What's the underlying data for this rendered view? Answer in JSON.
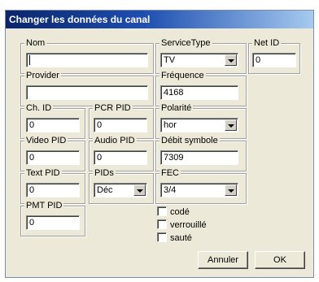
{
  "window": {
    "title": "Changer les données du canal"
  },
  "fields": {
    "nom": {
      "label": "Nom",
      "value": ""
    },
    "service_type": {
      "label": "ServiceType",
      "value": "TV"
    },
    "net_id": {
      "label": "Net ID",
      "value": "0"
    },
    "provider": {
      "label": "Provider",
      "value": ""
    },
    "frequence": {
      "label": "Fréquence",
      "value": "4168"
    },
    "ch_id": {
      "label": "Ch. ID",
      "value": "0"
    },
    "pcr_pid": {
      "label": "PCR PID",
      "value": "0"
    },
    "polarite": {
      "label": "Polarité",
      "value": "hor"
    },
    "video_pid": {
      "label": "Video PID",
      "value": "0"
    },
    "audio_pid": {
      "label": "Audio PID",
      "value": "0"
    },
    "debit_symbole": {
      "label": "Débit symbole",
      "value": "7309"
    },
    "text_pid": {
      "label": "Text PID",
      "value": "0"
    },
    "pids": {
      "label": "PIDs",
      "value": "Déc"
    },
    "fec": {
      "label": "FEC",
      "value": "3/4"
    },
    "pmt_pid": {
      "label": "PMT PID",
      "value": "0"
    }
  },
  "checkboxes": {
    "code": {
      "label": "codé",
      "checked": false
    },
    "verrouille": {
      "label": "verrouillé",
      "checked": false
    },
    "saute": {
      "label": "sauté",
      "checked": false
    }
  },
  "buttons": {
    "cancel": "Annuler",
    "ok": "OK"
  }
}
